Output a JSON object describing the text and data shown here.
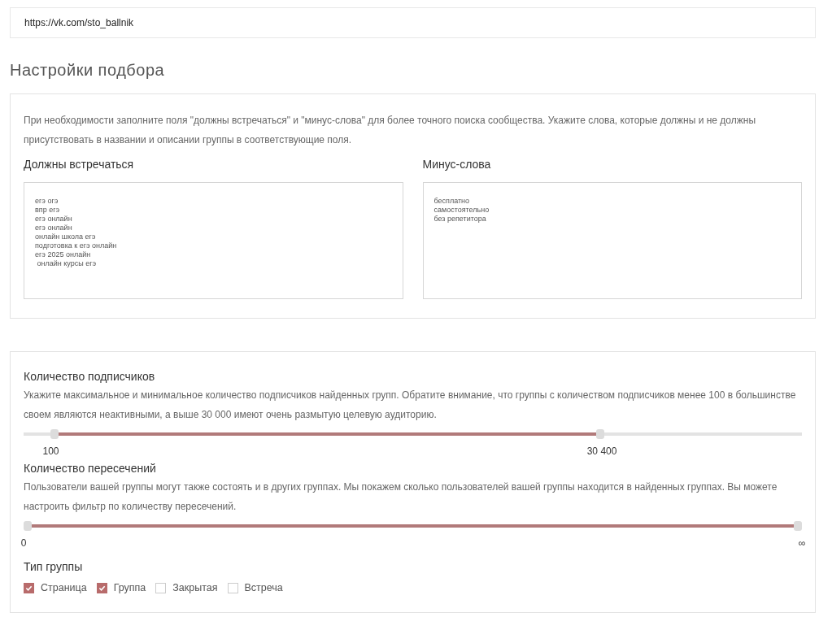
{
  "url_field": {
    "value": "https://vk.com/sto_ballnik"
  },
  "section_title": "Настройки подбора",
  "keywords": {
    "hint": "При необходимости заполните поля \"должны встречаться\" и \"минус-слова\" для более точного поиска сообщества. Укажите слова, которые должны и не должны присутствовать в названии и описании группы в соответствующие поля.",
    "fields": [
      {
        "label": "Должны встречаться",
        "lines": [
          "егэ огэ",
          "впр егэ",
          "егэ онлайн",
          "егэ онлайн",
          "онлайн школа егэ",
          "подготовка к егэ онлайн",
          "егэ 2025 онлайн",
          " онлайн курсы егэ"
        ]
      },
      {
        "label": "Минус-слова",
        "lines": [
          "бесплатно",
          "самостоятельно",
          "без репетитора"
        ]
      }
    ]
  },
  "filters": {
    "sliders": [
      {
        "label": "Количество подписчиков",
        "hint": "Укажите максимальное и минимальное количество подписчиков найденных групп. Обратите внимание, что группы с количеством подписчиков менее 100 в большинстве своем являются неактивными, а выше 30 000 имеют очень размытую целевую аудиторию.",
        "thumbs": [
          {
            "level": 0.035,
            "reading": "100"
          },
          {
            "level": 0.743,
            "reading": "30 400"
          }
        ]
      },
      {
        "label": "Количество пересечений",
        "hint": "Пользователи вашей группы могут также состоять и в других группах. Мы покажем сколько пользователей вашей группы находится в найденных группах. Вы можете настроить фильтр по количеству пересечений.",
        "thumbs": [
          {
            "level": 0,
            "reading": "0"
          },
          {
            "level": 1,
            "reading": "∞"
          }
        ]
      }
    ],
    "group_type": {
      "label": "Тип группы",
      "options": [
        {
          "label": "Страница",
          "checked": true
        },
        {
          "label": "Группа",
          "checked": true
        },
        {
          "label": "Закрытая",
          "checked": false
        },
        {
          "label": "Встреча",
          "checked": false
        }
      ]
    }
  }
}
